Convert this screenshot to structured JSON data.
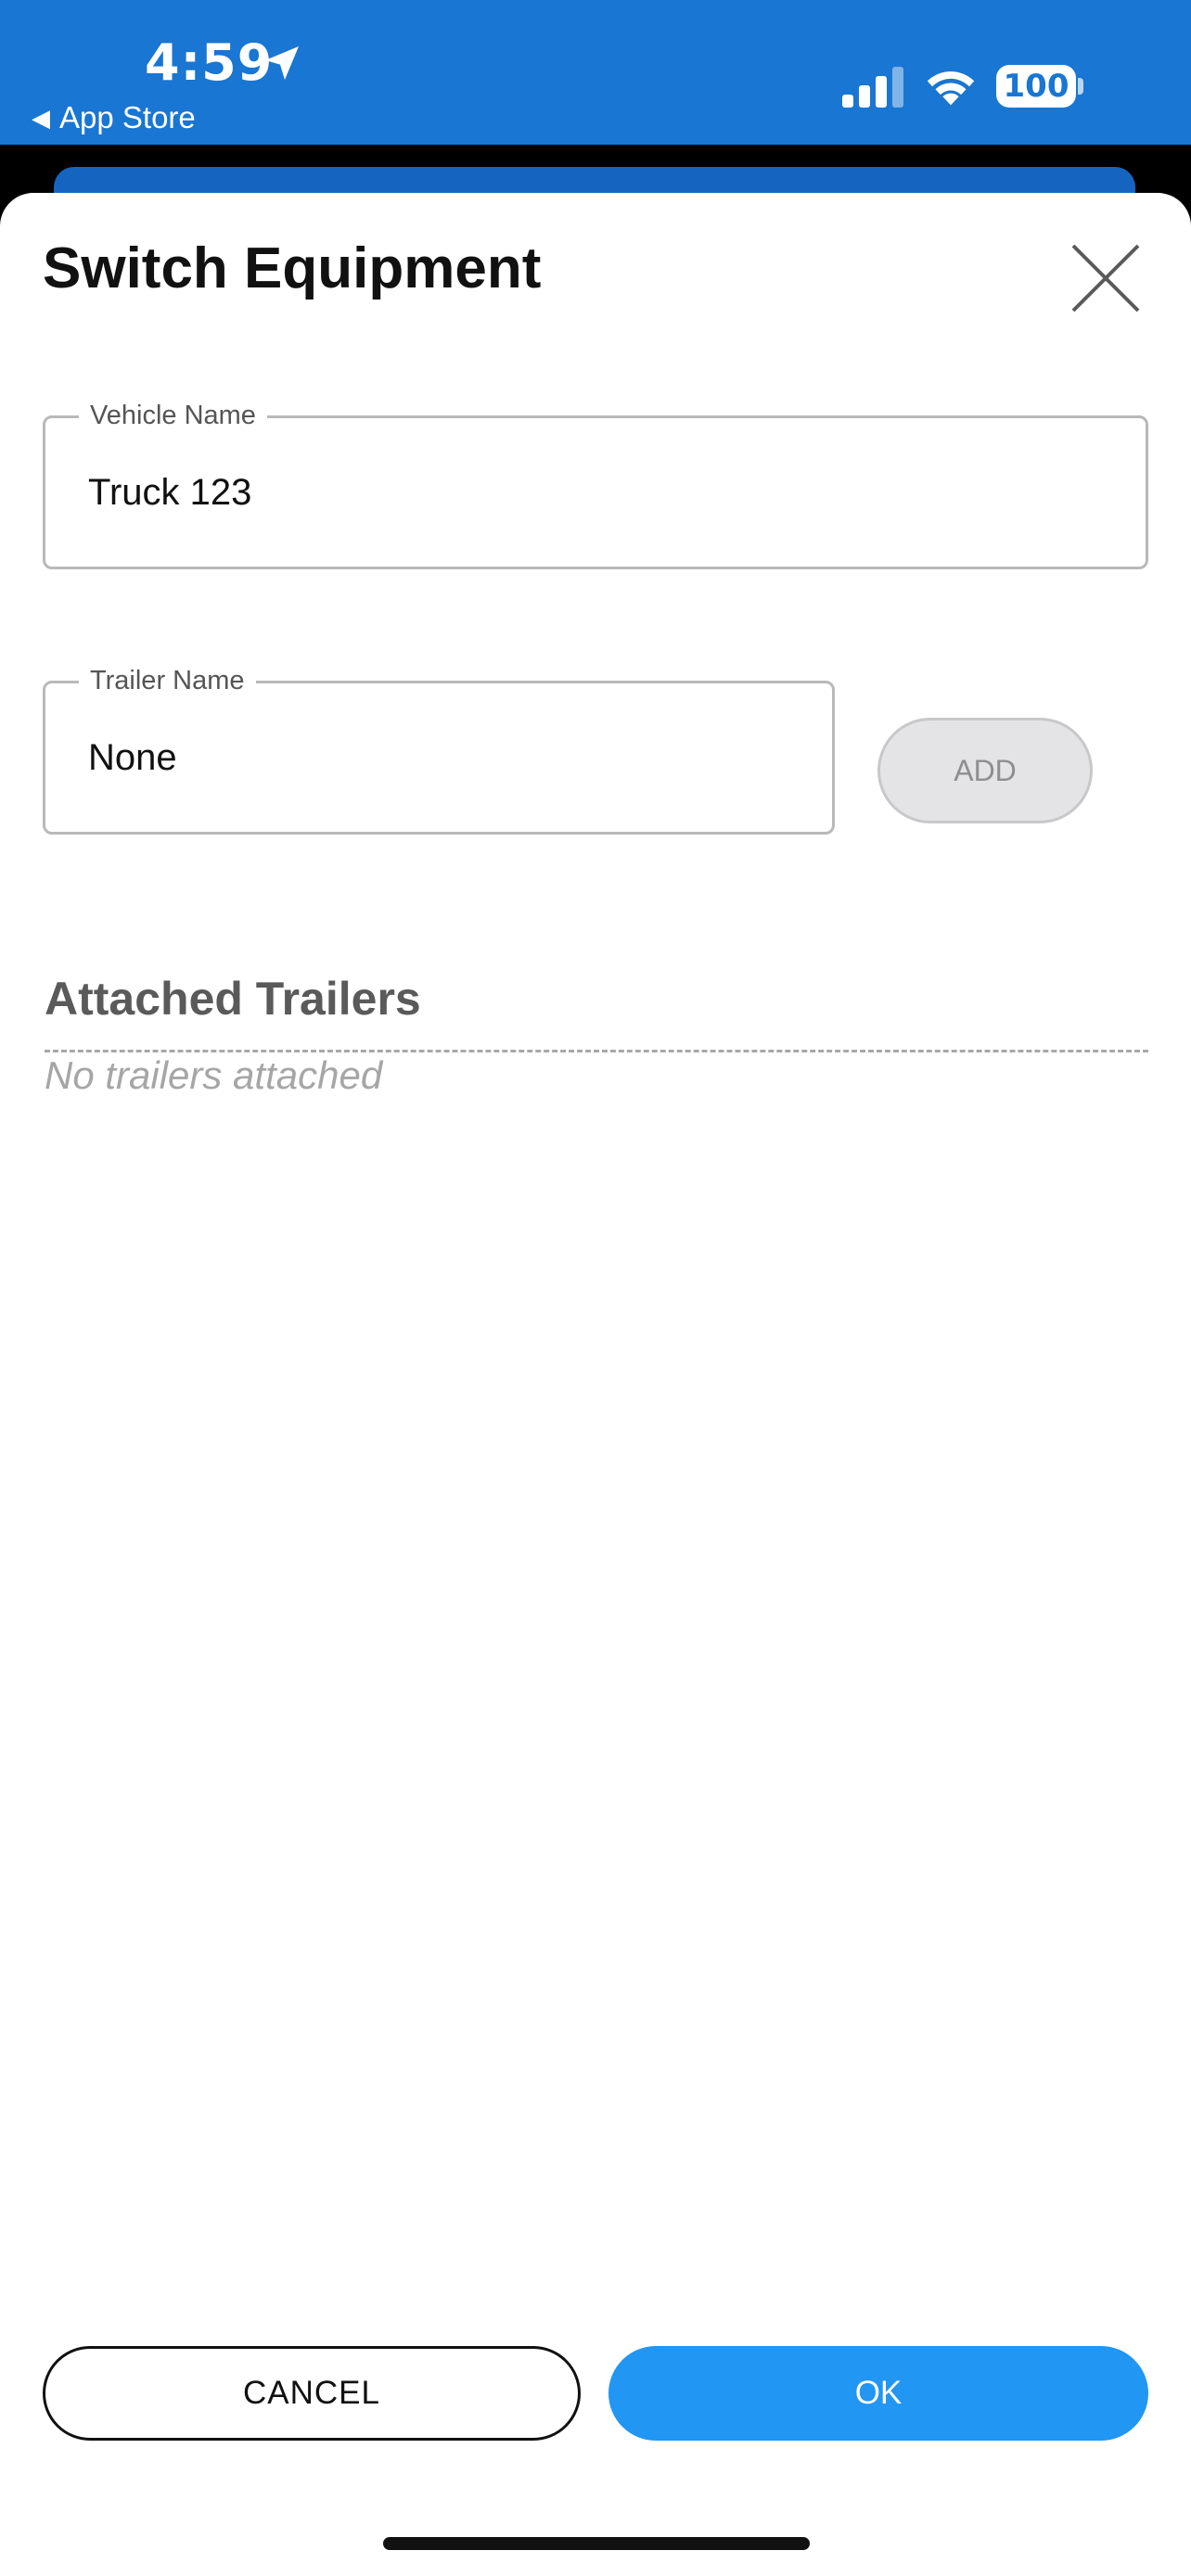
{
  "status_bar": {
    "time": "4:59",
    "back_app": "App Store",
    "battery": "100",
    "background_color": "#1976d2",
    "icons": [
      "location-arrow-icon",
      "cellular-signal-icon",
      "wifi-icon",
      "battery-icon"
    ]
  },
  "sheet": {
    "title": "Switch Equipment",
    "close_icon": "close-icon"
  },
  "vehicle_field": {
    "label": "Vehicle Name",
    "value": "Truck 123"
  },
  "trailer_field": {
    "label": "Trailer Name",
    "value": "None"
  },
  "add_button": {
    "label": "ADD"
  },
  "attached_trailers": {
    "title": "Attached Trailers",
    "empty_text": "No trailers attached"
  },
  "actions": {
    "cancel_label": "CANCEL",
    "ok_label": "OK",
    "ok_color": "#2196f3"
  }
}
